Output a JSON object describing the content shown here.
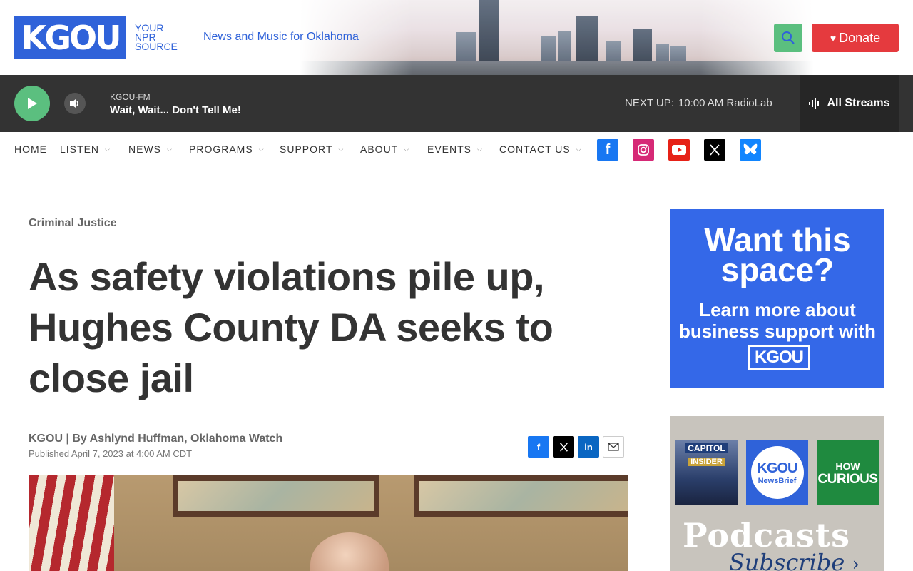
{
  "header": {
    "logo_text": "KGOU",
    "logo_tag": [
      "YOUR",
      "NPR",
      "SOURCE"
    ],
    "tagline": "News and Music for Oklahoma",
    "search_icon": "search-icon",
    "donate_label": "Donate",
    "colors": {
      "brand_blue": "#2f62d9",
      "donate_red": "#e53a3e",
      "accent_green": "#5bbf7f"
    }
  },
  "player": {
    "station": "KGOU-FM",
    "program": "Wait, Wait... Don't Tell Me!",
    "next_up_label": "NEXT UP:",
    "next_up_value": "10:00 AM RadioLab",
    "streams_label": "All Streams"
  },
  "nav": {
    "items": [
      {
        "label": "HOME",
        "has_menu": false
      },
      {
        "label": "LISTEN",
        "has_menu": true
      },
      {
        "label": "NEWS",
        "has_menu": true
      },
      {
        "label": "PROGRAMS",
        "has_menu": true
      },
      {
        "label": "SUPPORT",
        "has_menu": true
      },
      {
        "label": "ABOUT",
        "has_menu": true
      },
      {
        "label": "EVENTS",
        "has_menu": true
      },
      {
        "label": "CONTACT US",
        "has_menu": true
      }
    ],
    "social": [
      {
        "name": "facebook-icon",
        "glyph": "f",
        "color": "#1877f2"
      },
      {
        "name": "instagram-icon",
        "glyph": "◎",
        "color": "#d62976"
      },
      {
        "name": "youtube-icon",
        "glyph": "▶",
        "color": "#e62117"
      },
      {
        "name": "x-icon",
        "glyph": "𝕏",
        "color": "#000000"
      },
      {
        "name": "bluesky-icon",
        "glyph": "🦋",
        "color": "#1185fe"
      }
    ]
  },
  "article": {
    "kicker": "Criminal Justice",
    "headline": "As safety violations pile up, Hughes County DA seeks to close jail",
    "byline": "KGOU | By Ashlynd Huffman, Oklahoma Watch",
    "published": "Published April 7, 2023 at 4:00 AM CDT",
    "share": [
      {
        "name": "share-facebook-icon",
        "glyph": "f",
        "color": "#1877f2"
      },
      {
        "name": "share-x-icon",
        "glyph": "𝕏",
        "color": "#000000"
      },
      {
        "name": "share-linkedin-icon",
        "glyph": "in",
        "color": "#0a66c2"
      },
      {
        "name": "share-email-icon",
        "glyph": "✉",
        "color": "#ffffff"
      }
    ]
  },
  "sidebar": {
    "ad": {
      "headline": "Want this space?",
      "subtext": "Learn more about business support with",
      "logo": "KGOU"
    },
    "podcasts": {
      "tiles": [
        {
          "line1": "CAPITOL",
          "line2": "INSIDER",
          "color": "#2b3f6b"
        },
        {
          "line1": "KGOU",
          "line2": "NewsBrief",
          "color": "#2f62d9"
        },
        {
          "line1": "HOW",
          "line2": "CURIOUS",
          "color": "#1f8a3f"
        }
      ],
      "title": "Podcasts",
      "subtitle": "Subscribe"
    }
  }
}
